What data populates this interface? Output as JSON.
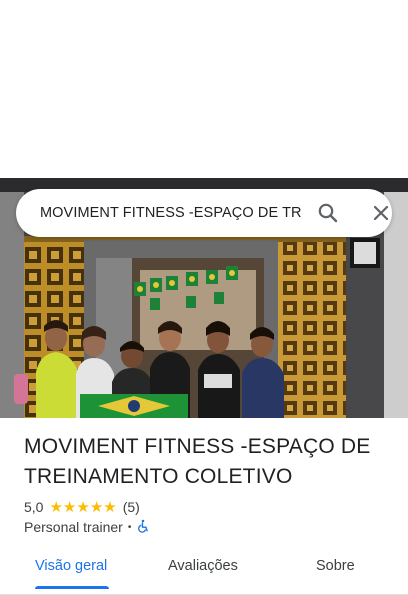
{
  "search": {
    "query": "MOVIMENT FITNESS -ESPAÇO DE TREINAMENTO COLETIVO",
    "icons": [
      "search-icon",
      "close-icon"
    ]
  },
  "place": {
    "name": "MOVIMENT FITNESS -ESPAÇO DE TREINAMENTO COLETIVO",
    "rating": "5,0",
    "stars": 5,
    "reviews": "(5)",
    "category": "Personal trainer",
    "separator": "•",
    "accessibility_icon": "wheelchair-icon"
  },
  "tabs": [
    {
      "label": "Visão geral",
      "selected": true
    },
    {
      "label": "Avaliações",
      "selected": false
    },
    {
      "label": "Sobre",
      "selected": false
    }
  ],
  "colors": {
    "accent": "#1a73e8",
    "star": "#fbbc04",
    "text": "#202124"
  }
}
